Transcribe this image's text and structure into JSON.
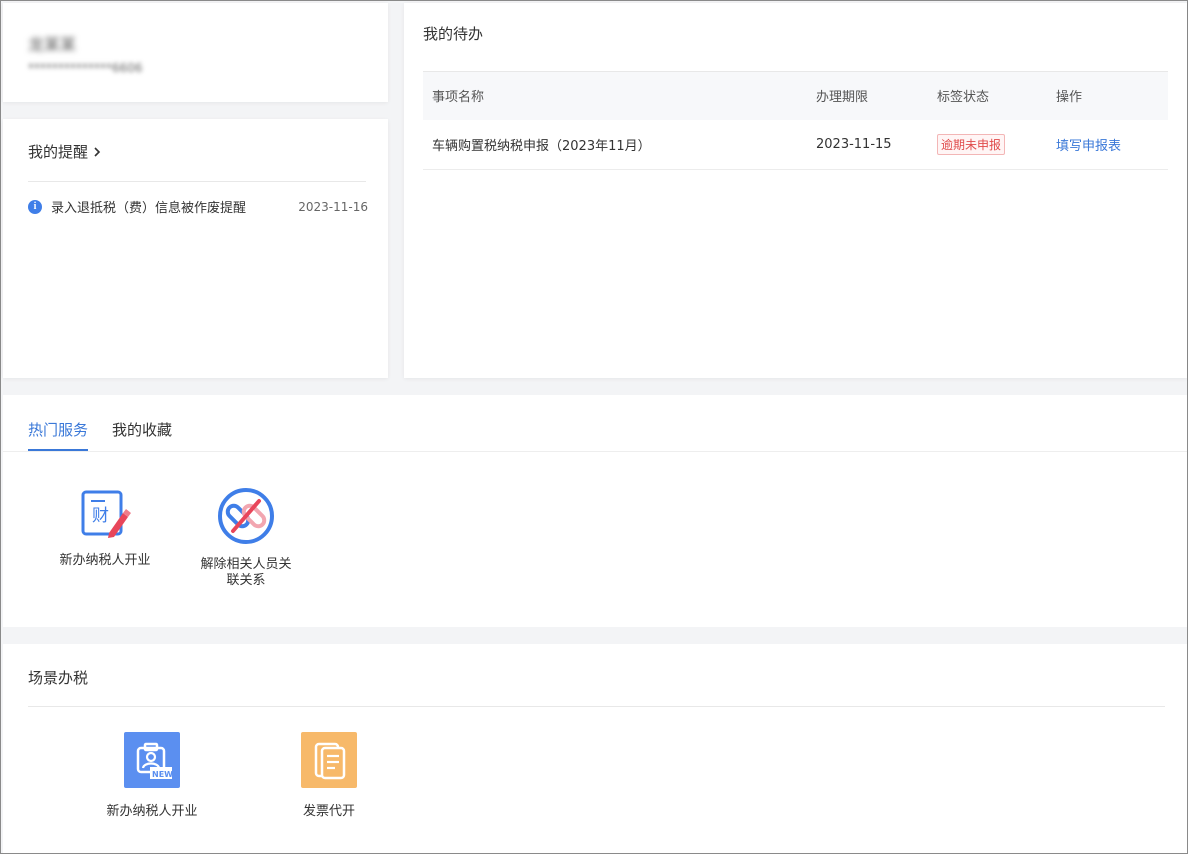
{
  "user": {
    "name": "龙某某",
    "id": "**************6606"
  },
  "reminders": {
    "title": "我的提醒",
    "items": [
      {
        "text": "录入退抵税（费）信息被作废提醒",
        "date": "2023-11-16"
      }
    ]
  },
  "todo": {
    "title": "我的待办",
    "headers": [
      "事项名称",
      "办理期限",
      "标签状态",
      "操作"
    ],
    "rows": [
      {
        "name": "车辆购置税纳税申报（2023年11月）",
        "deadline": "2023-11-15",
        "status": "逾期未申报",
        "action": "填写申报表"
      }
    ]
  },
  "services": {
    "tabs": [
      {
        "label": "热门服务",
        "active": true
      },
      {
        "label": "我的收藏",
        "active": false
      }
    ],
    "items": [
      {
        "label": "新办纳税人开业",
        "icon": "finance-edit-icon"
      },
      {
        "label_line1": "解除相关人员关",
        "label_line2": "联关系",
        "icon": "unlink-icon"
      }
    ]
  },
  "scenes": {
    "title": "场景办税",
    "items": [
      {
        "label": "新办纳税人开业",
        "icon": "new-taxpayer-icon",
        "badge": "NEW",
        "color": "#5b8ff0"
      },
      {
        "label": "发票代开",
        "icon": "invoice-icon",
        "color": "#f7b96a"
      }
    ]
  },
  "colors": {
    "accent": "#3a78d8",
    "danger": "#e04b4b"
  }
}
